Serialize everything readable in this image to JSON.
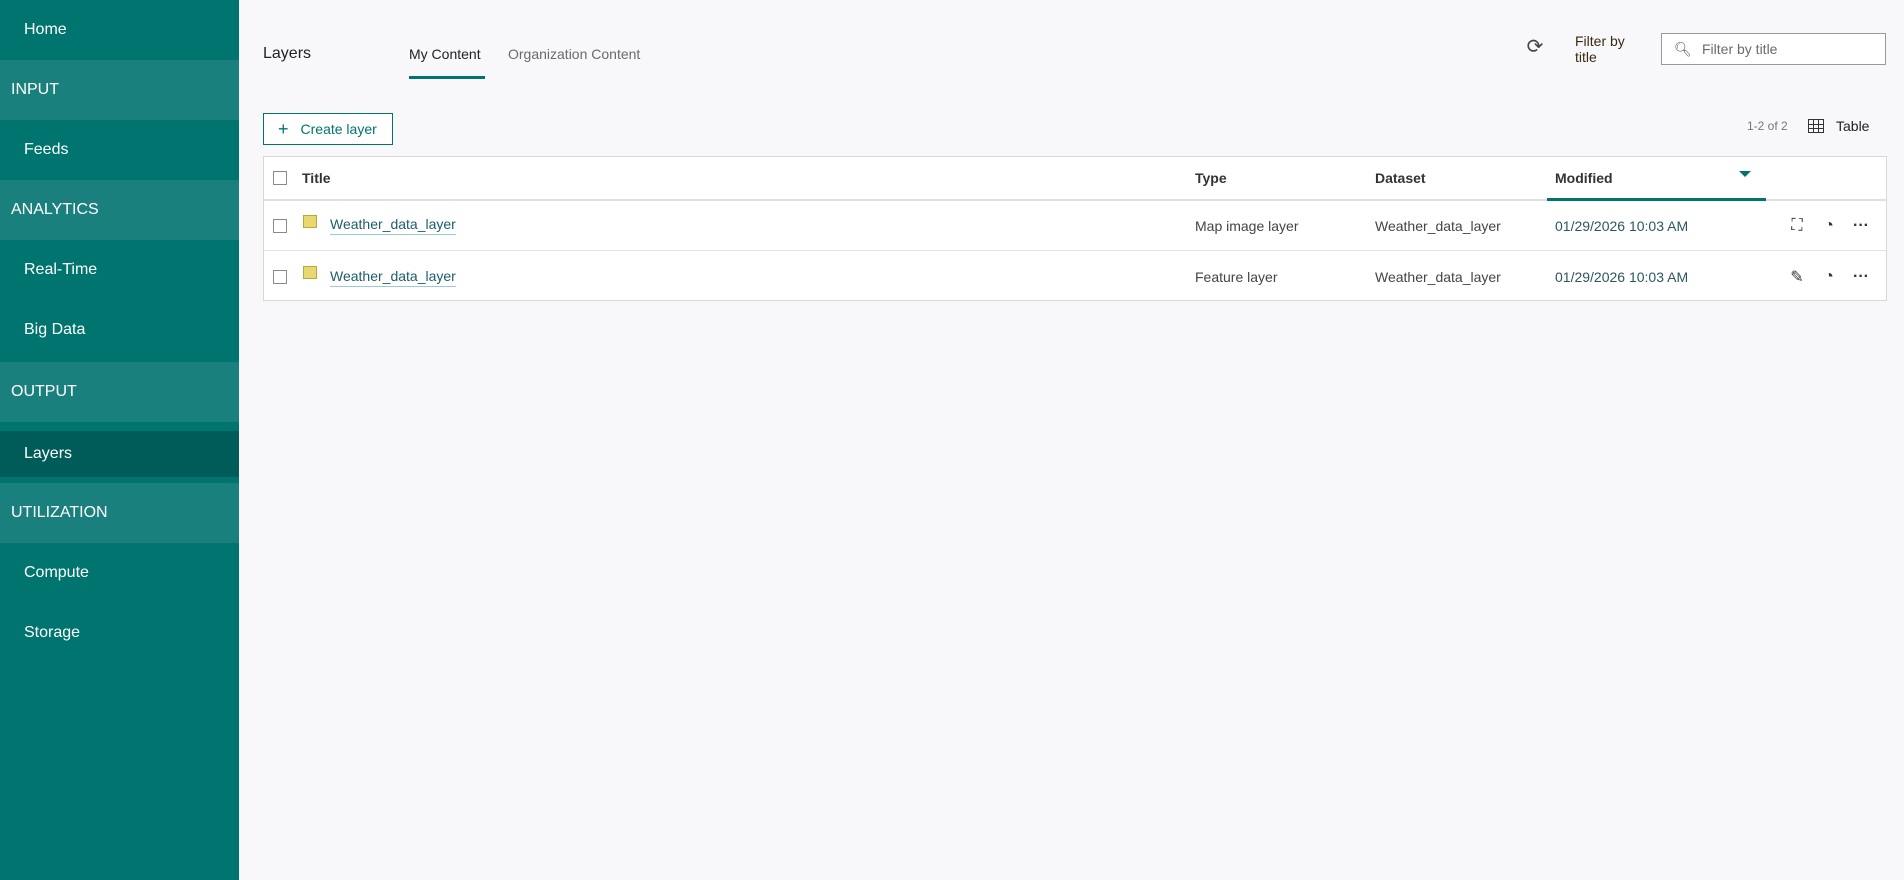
{
  "sidebar": {
    "items": [
      {
        "label": "Home",
        "kind": "item"
      },
      {
        "label": "INPUT",
        "kind": "group"
      },
      {
        "label": "Feeds",
        "kind": "item"
      },
      {
        "label": "ANALYTICS",
        "kind": "group"
      },
      {
        "label": "Real-Time",
        "kind": "item"
      },
      {
        "label": "Big Data",
        "kind": "item"
      },
      {
        "label": "OUTPUT",
        "kind": "group"
      },
      {
        "label": "Layers",
        "kind": "item",
        "selected": true
      },
      {
        "label": "UTILIZATION",
        "kind": "group"
      },
      {
        "label": "Compute",
        "kind": "item"
      },
      {
        "label": "Storage",
        "kind": "item"
      }
    ]
  },
  "header": {
    "title": "Layers",
    "tabs": [
      {
        "label": "My Content",
        "active": true
      },
      {
        "label": "Organization Content"
      }
    ],
    "filter_label": "Filter by title",
    "search_placeholder": "Filter by title"
  },
  "toolbar": {
    "create_label": "Create layer",
    "count": "1-2 of 2",
    "view_label": "Table"
  },
  "table": {
    "columns": [
      "Title",
      "Type",
      "Dataset",
      "Modified"
    ],
    "rows": [
      {
        "title": "Weather_data_layer",
        "type": "Map image layer",
        "dataset": "Weather_data_layer",
        "modified": "01/29/2026 10:03 AM",
        "icon": "map-image-layer-icon"
      },
      {
        "title": "Weather_data_layer",
        "type": "Feature layer",
        "dataset": "Weather_data_layer",
        "modified": "01/29/2026 10:03 AM",
        "icon": "feature-layer-icon"
      }
    ]
  },
  "colors": {
    "accent": "#00746f",
    "sidebar": "#00746f",
    "sidebar_group": "#1a807d",
    "sidebar_selected": "#005c59"
  }
}
